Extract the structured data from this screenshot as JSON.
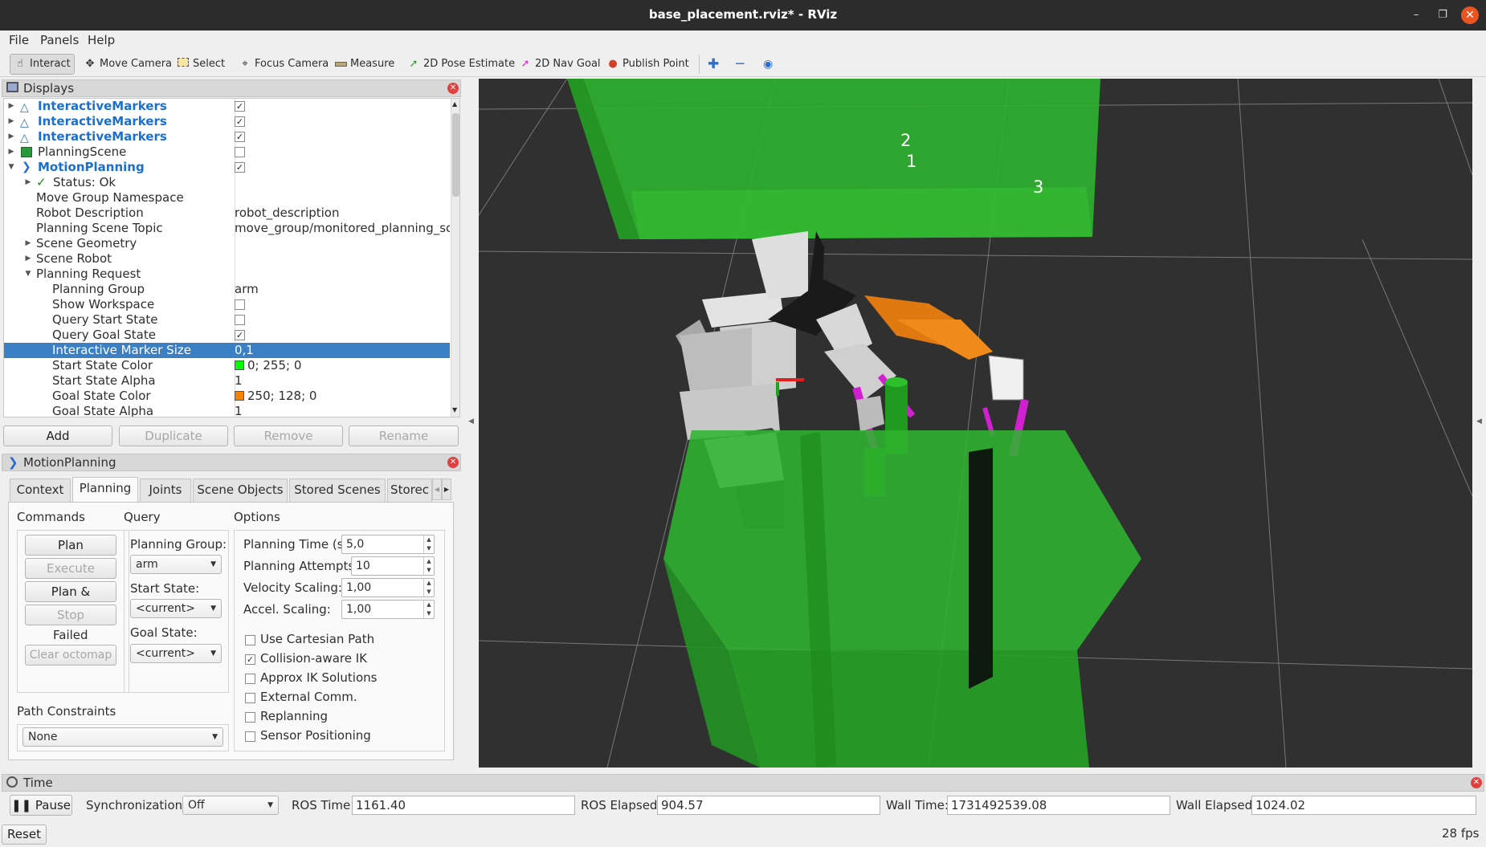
{
  "window": {
    "title": "base_placement.rviz* - RViz"
  },
  "menu": [
    "File",
    "Panels",
    "Help"
  ],
  "toolbar": {
    "tools": [
      "Interact",
      "Move Camera",
      "Select",
      "Focus Camera",
      "Measure",
      "2D Pose Estimate",
      "2D Nav Goal",
      "Publish Point"
    ],
    "active": "Interact"
  },
  "displays": {
    "title": "Displays",
    "rows": [
      {
        "name": "InteractiveMarkers",
        "checked": true
      },
      {
        "name": "InteractiveMarkers",
        "checked": true
      },
      {
        "name": "InteractiveMarkers",
        "checked": true
      },
      {
        "name": "PlanningScene",
        "checked": false
      },
      {
        "name": "MotionPlanning",
        "checked": true
      },
      {
        "name": "Status: Ok"
      },
      {
        "name": "Move Group Namespace",
        "value": ""
      },
      {
        "name": "Robot Description",
        "value": "robot_description"
      },
      {
        "name": "Planning Scene Topic",
        "value": "move_group/monitored_planning_sc..."
      },
      {
        "name": "Scene Geometry"
      },
      {
        "name": "Scene Robot"
      },
      {
        "name": "Planning Request"
      },
      {
        "name": "Planning Group",
        "value": "arm"
      },
      {
        "name": "Show Workspace",
        "checked": false
      },
      {
        "name": "Query Start State",
        "checked": false
      },
      {
        "name": "Query Goal State",
        "checked": true
      },
      {
        "name": "Interactive Marker Size",
        "value": "0,1"
      },
      {
        "name": "Start State Color",
        "value": "0; 255; 0",
        "color": "#00ff00"
      },
      {
        "name": "Start State Alpha",
        "value": "1"
      },
      {
        "name": "Goal State Color",
        "value": "250; 128; 0",
        "color": "#fa8000"
      },
      {
        "name": "Goal State Alpha",
        "value": "1"
      }
    ],
    "buttons": [
      "Add",
      "Duplicate",
      "Remove",
      "Rename"
    ]
  },
  "motion_planning": {
    "title": "MotionPlanning",
    "tabs": [
      "Context",
      "Planning",
      "Joints",
      "Scene Objects",
      "Stored Scenes",
      "Storec"
    ],
    "active_tab": "Planning",
    "commands": {
      "title": "Commands",
      "plan": "Plan",
      "execute": "Execute",
      "plan_execute": "Plan & Execute",
      "stop": "Stop",
      "status": "Failed",
      "clear_octomap": "Clear octomap"
    },
    "query": {
      "title": "Query",
      "planning_group_label": "Planning Group:",
      "planning_group": "arm",
      "start_state_label": "Start State:",
      "start_state": "<current>",
      "goal_state_label": "Goal State:",
      "goal_state": "<current>"
    },
    "options": {
      "title": "Options",
      "planning_time_label": "Planning Time (s):",
      "planning_time": "5,0",
      "planning_attempts_label": "Planning Attempts:",
      "planning_attempts": "10",
      "velocity_scaling_label": "Velocity Scaling:",
      "velocity_scaling": "1,00",
      "accel_scaling_label": "Accel. Scaling:",
      "accel_scaling": "1,00",
      "checks": [
        {
          "label": "Use Cartesian Path",
          "checked": false
        },
        {
          "label": "Collision-aware IK",
          "checked": true
        },
        {
          "label": "Approx IK Solutions",
          "checked": false
        },
        {
          "label": "External Comm.",
          "checked": false
        },
        {
          "label": "Replanning",
          "checked": false
        },
        {
          "label": "Sensor Positioning",
          "checked": false
        }
      ]
    },
    "path_constraints": {
      "label": "Path Constraints",
      "value": "None"
    }
  },
  "viewport": {
    "labels": [
      "2",
      "1",
      "3"
    ]
  },
  "time": {
    "title": "Time",
    "pause": "Pause",
    "sync_label": "Synchronization:",
    "sync_value": "Off",
    "ros_time_label": "ROS Time:",
    "ros_time": "1161.40",
    "ros_elapsed_label": "ROS Elapsed:",
    "ros_elapsed": "904.57",
    "wall_time_label": "Wall Time:",
    "wall_time": "1731492539.08",
    "wall_elapsed_label": "Wall Elapsed:",
    "wall_elapsed": "1024.02",
    "reset": "Reset",
    "fps": "28 fps"
  }
}
